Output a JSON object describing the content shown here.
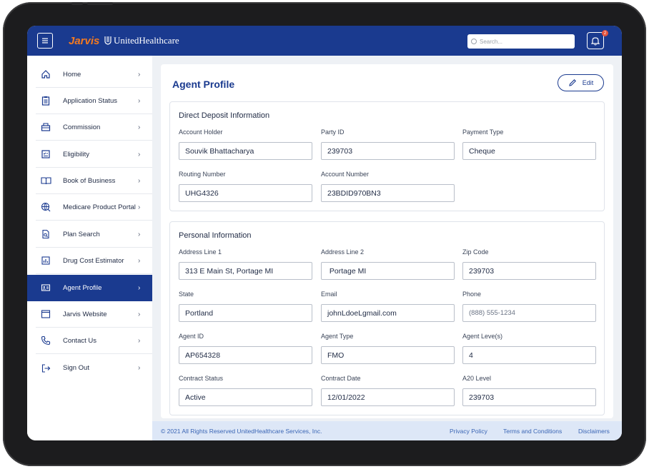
{
  "header": {
    "menu_icon": "hamburger-icon",
    "brand_jarvis": "Jarvis",
    "brand_uhc": "UnitedHealthcare",
    "search_placeholder": "Search...",
    "notification_count": "2"
  },
  "sidebar": {
    "items": [
      {
        "label": "Home",
        "icon": "home-icon",
        "active": false
      },
      {
        "label": "Application Status",
        "icon": "clipboard-icon",
        "active": false
      },
      {
        "label": "Commission",
        "icon": "commission-icon",
        "active": false
      },
      {
        "label": "Eligibility",
        "icon": "eligibility-icon",
        "active": false
      },
      {
        "label": "Book of Business",
        "icon": "book-icon",
        "active": false
      },
      {
        "label": "Medicare Product Portal",
        "icon": "globe-icon",
        "active": false
      },
      {
        "label": "Plan Search",
        "icon": "document-search-icon",
        "active": false
      },
      {
        "label": "Drug Cost Estimator",
        "icon": "chart-icon",
        "active": false
      },
      {
        "label": "Agent Profile",
        "icon": "id-card-icon",
        "active": true
      },
      {
        "label": "Jarvis Website",
        "icon": "browser-icon",
        "active": false
      },
      {
        "label": "Contact Us",
        "icon": "phone-icon",
        "active": false
      },
      {
        "label": "Sign Out",
        "icon": "sign-out-icon",
        "active": false
      }
    ]
  },
  "main": {
    "title": "Agent Profile",
    "edit_label": "Edit",
    "direct_deposit": {
      "title": "Direct Deposit Information",
      "fields": [
        {
          "label": "Account Holder",
          "value": "Souvik Bhattacharya"
        },
        {
          "label": "Party ID",
          "value": "239703"
        },
        {
          "label": "Payment Type",
          "value": "Cheque"
        },
        {
          "label": "Routing Number",
          "value": "UHG4326"
        },
        {
          "label": "Account Number",
          "value": "23BDID970BN3"
        }
      ]
    },
    "personal": {
      "title": "Personal Information",
      "fields": [
        {
          "label": "Address Line 1",
          "value": "313 E Main St, Portage MI"
        },
        {
          "label": "Address Line 2",
          "value": " Portage MI"
        },
        {
          "label": "Zip Code",
          "value": "239703"
        },
        {
          "label": "State",
          "value": "Portland"
        },
        {
          "label": "Email",
          "value": "johnLdoeLgmail.com"
        },
        {
          "label": "Phone",
          "value": "",
          "placeholder": "(888) 555-1234"
        },
        {
          "label": "Agent ID",
          "value": "AP654328"
        },
        {
          "label": "Agent Type",
          "value": "FMO"
        },
        {
          "label": "Agent Leve(s)",
          "value": "4"
        },
        {
          "label": "Contract Status",
          "value": "Active"
        },
        {
          "label": "Contract Date",
          "value": "12/01/2022"
        },
        {
          "label": "A20 Level",
          "value": "239703"
        }
      ]
    }
  },
  "footer": {
    "copyright": "© 2021 All Rights Reserved UnitedHealthcare Services, Inc.",
    "links": [
      "Privacy Policy",
      "Terms and Conditions",
      "Disclaimers"
    ]
  },
  "colors": {
    "primary": "#1a3a8f",
    "brand_orange": "#f47a20",
    "footer_bg": "#dde7f7",
    "badge": "#e5533d"
  }
}
